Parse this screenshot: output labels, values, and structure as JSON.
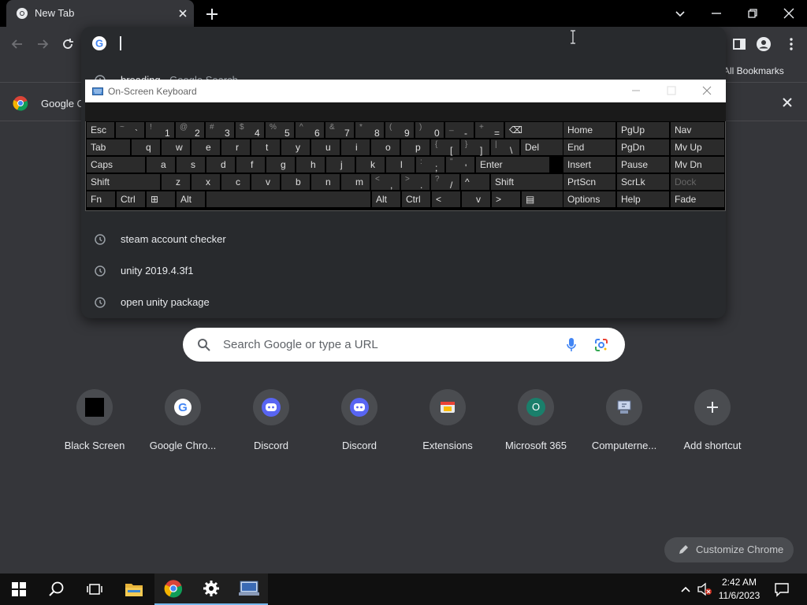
{
  "browser": {
    "tab_title": "New Tab",
    "all_bookmarks": "All Bookmarks",
    "infobar_text": "Google C"
  },
  "omnibox": {
    "suggestions": [
      {
        "text": "breading",
        "sub": " - Google Search"
      },
      {
        "text": "steam account checker",
        "sub": ""
      },
      {
        "text": "unity 2019.4.3f1",
        "sub": ""
      },
      {
        "text": "open unity package",
        "sub": ""
      }
    ]
  },
  "ntp": {
    "search_placeholder": "Search Google or type a URL",
    "shortcuts": [
      {
        "label": "Black Screen",
        "icon": "black-square-icon"
      },
      {
        "label": "Google Chro...",
        "icon": "google-g-icon"
      },
      {
        "label": "Discord",
        "icon": "discord-icon"
      },
      {
        "label": "Discord",
        "icon": "discord-icon"
      },
      {
        "label": "Extensions",
        "icon": "extensions-icon"
      },
      {
        "label": "Microsoft 365",
        "icon": "letter-o-icon",
        "letter": "O"
      },
      {
        "label": "Computerne...",
        "icon": "computer-icon"
      },
      {
        "label": "Add shortcut",
        "icon": "plus-icon"
      }
    ],
    "customize_label": "Customize Chrome"
  },
  "osk": {
    "title": "On-Screen Keyboard",
    "rows": [
      [
        "Esc",
        "~ `",
        "! 1",
        "@ 2",
        "# 3",
        "$ 4",
        "% 5",
        "^ 6",
        "& 7",
        "* 8",
        "( 9",
        ") 0",
        "_ -",
        "+ =",
        "⌫"
      ],
      [
        "Tab",
        "q",
        "w",
        "e",
        "r",
        "t",
        "y",
        "u",
        "i",
        "o",
        "p",
        "{ [",
        "} ]",
        "| \\",
        "Del"
      ],
      [
        "Caps",
        "a",
        "s",
        "d",
        "f",
        "g",
        "h",
        "j",
        "k",
        "l",
        ": ;",
        "\" '",
        "Enter"
      ],
      [
        "Shift",
        "z",
        "x",
        "c",
        "v",
        "b",
        "n",
        "m",
        "< ,",
        "> .",
        "? /",
        "^",
        "Shift"
      ],
      [
        "Fn",
        "Ctrl",
        "⊞",
        "Alt",
        "",
        "Alt",
        "Ctrl",
        "<",
        "v",
        ">",
        "▤"
      ]
    ],
    "nav_keys": [
      [
        "Home",
        "PgUp",
        "Nav"
      ],
      [
        "End",
        "PgDn",
        "Mv Up"
      ],
      [
        "Insert",
        "Pause",
        "Mv Dn"
      ],
      [
        "PrtScn",
        "ScrLk",
        "Dock"
      ],
      [
        "Options",
        "Help",
        "Fade"
      ]
    ]
  },
  "taskbar": {
    "time": "2:42 AM",
    "date": "11/6/2023"
  },
  "colors": {
    "chrome_bg": "#35363a",
    "omnibox_bg": "#282a2d",
    "discord": "#5865f2",
    "m365_green": "#1a7f6b",
    "taskbar_accent": "#76b9ed"
  }
}
